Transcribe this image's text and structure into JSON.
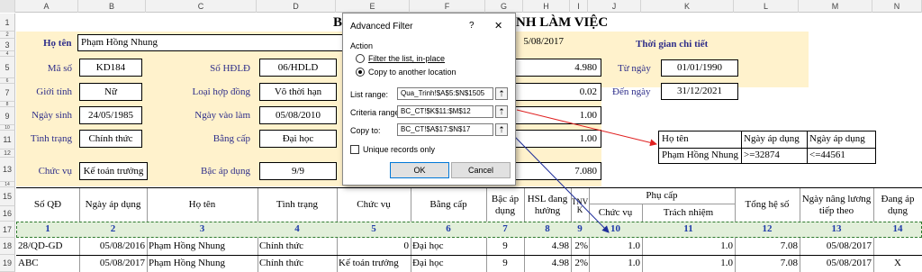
{
  "columns": [
    "A",
    "B",
    "C",
    "D",
    "E",
    "F",
    "G",
    "H",
    "I",
    "J",
    "K",
    "L",
    "M",
    "N"
  ],
  "row_numbers": [
    "1",
    "2",
    "3",
    "4",
    "5",
    "6",
    "7",
    "8",
    "9",
    "10",
    "11",
    "12",
    "13",
    "14",
    "15",
    "16",
    "17",
    "18",
    "19"
  ],
  "title_visible": "B",
  "title_right": "NH  LÀM VIỆC",
  "form": {
    "ho_ten_label": "Họ tên",
    "ho_ten": "Phạm Hồng Nhung",
    "ma_so_label": "Mã số",
    "ma_so": "KD184",
    "so_hddl_label": "Số HĐLĐ",
    "so_hddl": "06/HDLD",
    "gioi_tinh_label": "Giới tính",
    "gioi_tinh": "Nữ",
    "loai_hd_label": "Loại hợp đồng",
    "loai_hd": "Vô thời hạn",
    "ngay_sinh_label": "Ngày sinh",
    "ngay_sinh": "24/05/1985",
    "ngay_vao_label": "Ngày vào làm",
    "ngay_vao": "05/08/2010",
    "tinh_trang_label": "Tình trạng",
    "tinh_trang": "Chính thức",
    "bang_cap_label": "Bằng cấp",
    "bang_cap": "Đại học",
    "chuc_vu_label": "Chức vụ",
    "chuc_vu": "Kế toán trưởng",
    "bac_label": "Bậc áp dụng",
    "bac": "9/9"
  },
  "mid_values": [
    "5/08/2017",
    "4.980",
    "0.02",
    "1.00",
    "1.00",
    "7.080"
  ],
  "right_panel": {
    "title": "Thời gian chi tiết",
    "tu_ngay_label": "Từ ngày",
    "tu_ngay": "01/01/1990",
    "den_ngay_label": "Đến ngày",
    "den_ngay": "31/12/2021"
  },
  "criteria": {
    "headers": [
      "Họ tên",
      "Ngày áp dụng",
      "Ngày áp dụng"
    ],
    "values": [
      "Phạm Hồng Nhung",
      ">=32874",
      "<=44561"
    ]
  },
  "table": {
    "headers": {
      "so_qd": "Số QĐ",
      "ngay_ad": "Ngày áp dụng",
      "ho_ten": "Họ tên",
      "tinh_trang": "Tình trạng",
      "chuc_vu": "Chức vụ",
      "bang_cap": "Bằng cấp",
      "bac": "Bậc áp dụng",
      "hsl": "HSL đang hưởng",
      "tnvk": "TNVK",
      "phu_cap": "Phụ cấp",
      "pc_chuc_vu": "Chức vụ",
      "pc_trach_nhiem": "Trách nhiệm",
      "tong_hs": "Tổng hệ số",
      "ngay_nang": "Ngày nâng lương tiếp theo",
      "dang_ad": "Đang áp dụng"
    },
    "col_numbers": [
      "1",
      "2",
      "3",
      "4",
      "5",
      "6",
      "7",
      "8",
      "9",
      "10",
      "11",
      "12",
      "13",
      "14"
    ],
    "rows": [
      [
        "28/QD-GD",
        "05/08/2016",
        "Phạm Hồng Nhung",
        "Chính thức",
        "0",
        "Đại học",
        "9",
        "4.98",
        "2%",
        "1.0",
        "1.0",
        "7.08",
        "05/08/2017",
        ""
      ],
      [
        "ABC",
        "05/08/2017",
        "Phạm Hồng Nhung",
        "Chính thức",
        "Kế toán trưởng",
        "Đại học",
        "9",
        "4.98",
        "2%",
        "1.0",
        "1.0",
        "7.08",
        "05/08/2017",
        "X"
      ]
    ]
  },
  "dialog": {
    "title": "Advanced Filter",
    "help": "?",
    "close": "✕",
    "action_label": "Action",
    "opt_in_place": "Filter the list, in-place",
    "opt_copy": "Copy to another location",
    "list_range_label": "List range:",
    "list_range": "Qua_Trinh!$A$5:$N$1505",
    "criteria_label": "Criteria range:",
    "criteria": "BC_CT!$K$11:$M$12",
    "copy_to_label": "Copy to:",
    "copy_to": "BC_CT!$A$17:$N$17",
    "unique_label": "Unique records only",
    "ok": "OK",
    "cancel": "Cancel"
  },
  "colors": {
    "panel": "#fff2cc",
    "label": "#2e2e8a",
    "number": "#1f3aa8",
    "arrow_red": "#e02020",
    "arrow_blue": "#1f2e9a",
    "row17": "#e2efda"
  }
}
